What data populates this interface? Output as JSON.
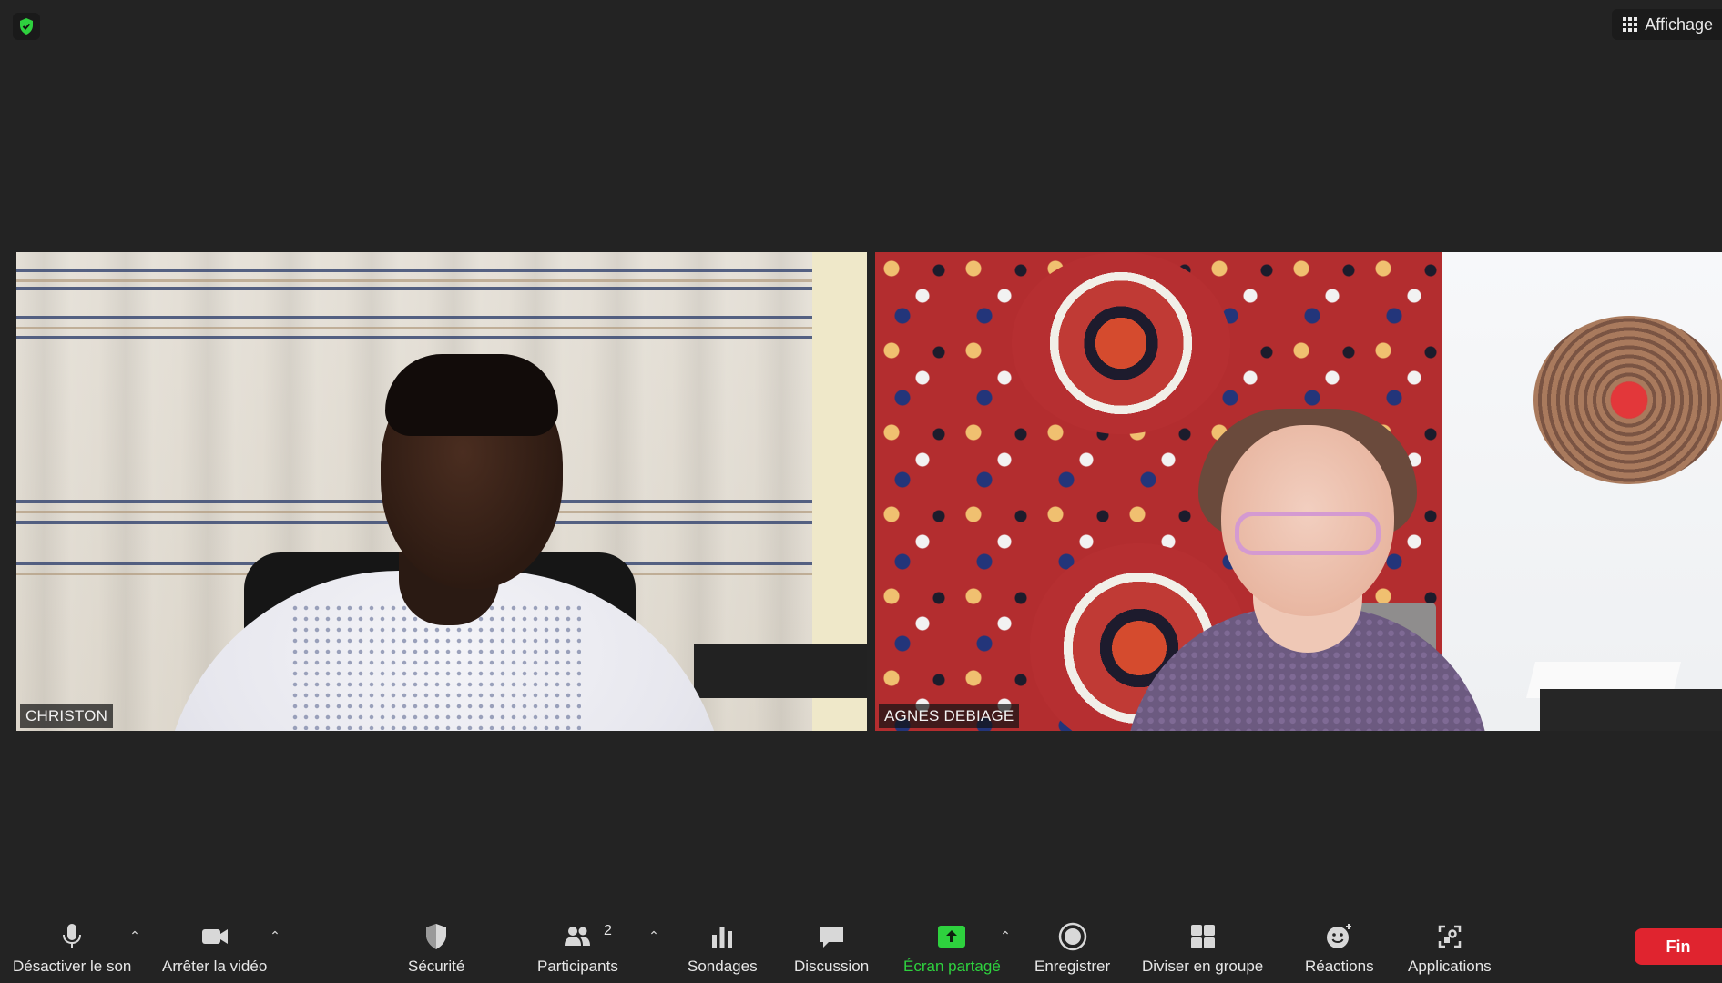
{
  "top": {
    "view_label": "Affichage"
  },
  "participants": [
    {
      "name": "CHRISTON"
    },
    {
      "name": "AGNES DEBIAGE"
    }
  ],
  "toolbar": {
    "mute_label": "Désactiver le son",
    "video_label": "Arrêter la vidéo",
    "security_label": "Sécurité",
    "participants_label": "Participants",
    "participants_count": "2",
    "polls_label": "Sondages",
    "chat_label": "Discussion",
    "share_label": "Écran partagé",
    "record_label": "Enregistrer",
    "breakout_label": "Diviser en groupe",
    "reactions_label": "Réactions",
    "apps_label": "Applications",
    "end_label": "Fin"
  },
  "colors": {
    "background": "#232323",
    "share_active": "#2ed13e",
    "end_button": "#e0242f",
    "security_badge": "#2ed13e"
  }
}
